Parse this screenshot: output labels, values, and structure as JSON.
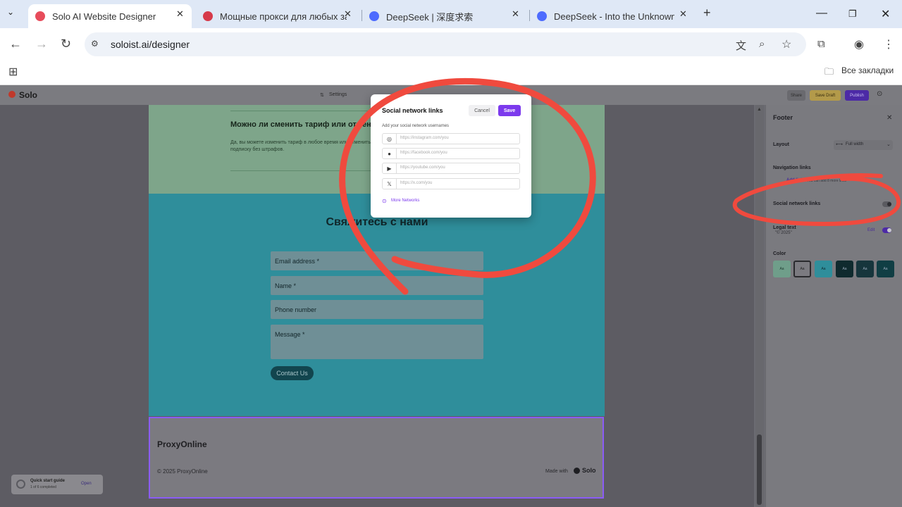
{
  "browser": {
    "tabs": [
      {
        "title": "Solo AI Website Designer"
      },
      {
        "title": "Мощные прокси для любых задач"
      },
      {
        "title": "DeepSeek | 深度求索"
      },
      {
        "title": "DeepSeek - Into the Unknown"
      }
    ],
    "url": "soloist.ai/designer",
    "bookmarks_label": "Все закладки"
  },
  "app": {
    "logo": "Solo",
    "toolbar_settings": "Settings",
    "share": "Share",
    "save_draft": "Save Draft",
    "publish": "Publish"
  },
  "page": {
    "faq_question": "Можно ли сменить тариф или отменить подписку?",
    "faq_answer": "Да, вы можете изменить тариф в любое время или отменить подписку без штрафов.",
    "contact_title": "Свяжитесь с нами",
    "email_label": "Email address *",
    "name_label": "Name *",
    "phone_label": "Phone number",
    "message_label": "Message *",
    "contact_button": "Contact Us",
    "footer_brand": "ProxyOnline",
    "copyright": "© 2025 ProxyOnline",
    "made_with": "Made with",
    "made_with_logo": "Solo"
  },
  "panel": {
    "title": "Footer",
    "layout_label": "Layout",
    "layout_value": "Full width",
    "nav_links_label": "Navigation links",
    "add_link": "Add link",
    "add_link_hint": "You can add 8 more links",
    "social_label": "Social network links",
    "legal_label": "Legal text",
    "legal_value": "\"© 2025\"",
    "edit": "Edit",
    "color_label": "Color",
    "swatch_text": "Aa"
  },
  "modal": {
    "title": "Social network links",
    "cancel": "Cancel",
    "save": "Save",
    "subtitle": "Add your social network usernames",
    "inputs": [
      {
        "icon": "instagram-icon",
        "placeholder": "https://instagram.com/you"
      },
      {
        "icon": "facebook-icon",
        "placeholder": "https://facebook.com/you"
      },
      {
        "icon": "youtube-icon",
        "placeholder": "https://youtube.com/you"
      },
      {
        "icon": "x-icon",
        "placeholder": "https://x.com/you"
      }
    ],
    "more": "More Networks"
  },
  "guide": {
    "title": "Quick start guide",
    "progress": "1 of 6 completed",
    "open": "Open"
  },
  "colors": {
    "accent": "#7c3aed",
    "annotation": "#f04a3e"
  }
}
